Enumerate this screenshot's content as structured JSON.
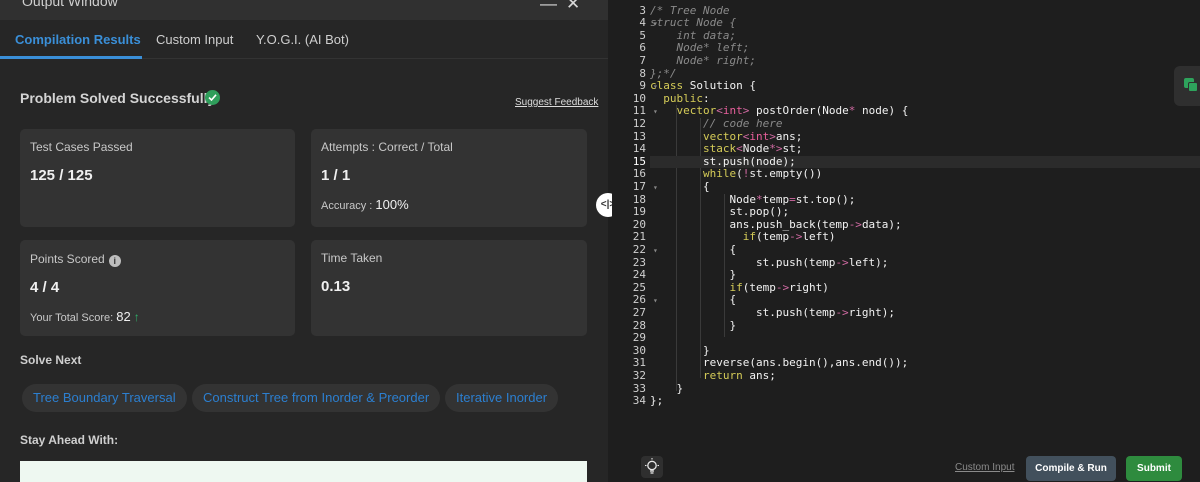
{
  "output_window": {
    "title": "Output Window",
    "minimize": "—",
    "close": "✕",
    "tabs": [
      "Compilation Results",
      "Custom Input",
      "Y.O.G.I. (AI Bot)"
    ],
    "status": "Problem Solved Successfully",
    "suggest_feedback": "Suggest Feedback",
    "cards": {
      "test_cases": {
        "label": "Test Cases Passed",
        "value": "125 / 125"
      },
      "attempts": {
        "label": "Attempts : Correct / Total",
        "value": "1 / 1",
        "accuracy_label": "Accuracy :",
        "accuracy_value": "100%"
      },
      "points": {
        "label": "Points Scored",
        "info": "i",
        "value": "4 / 4",
        "total_label": "Your Total Score:",
        "total_value": "82",
        "trend": "↑"
      },
      "time": {
        "label": "Time Taken",
        "value": "0.13"
      }
    },
    "solve_next": {
      "heading": "Solve Next",
      "items": [
        "Tree Boundary Traversal",
        "Construct Tree from Inorder & Preorder",
        "Iterative Inorder"
      ]
    },
    "stay_ahead": "Stay Ahead With:"
  },
  "splitter_icon": "<|>",
  "editor": {
    "line_numbers": [
      "3",
      "4",
      "5",
      "6",
      "7",
      "8",
      "9",
      "10",
      "11",
      "12",
      "13",
      "14",
      "15",
      "16",
      "17",
      "18",
      "19",
      "20",
      "21",
      "22",
      "23",
      "24",
      "25",
      "26",
      "27",
      "28",
      "29",
      "30",
      "31",
      "32",
      "33",
      "34"
    ],
    "current_line": "15"
  },
  "bottom_bar": {
    "custom_input": "Custom Input",
    "compile_run": "Compile & Run",
    "submit": "Submit"
  },
  "colors": {
    "accent_blue": "#3a8fd8",
    "success_green": "#2f9e5b",
    "submit_green": "#2e8b3e"
  }
}
